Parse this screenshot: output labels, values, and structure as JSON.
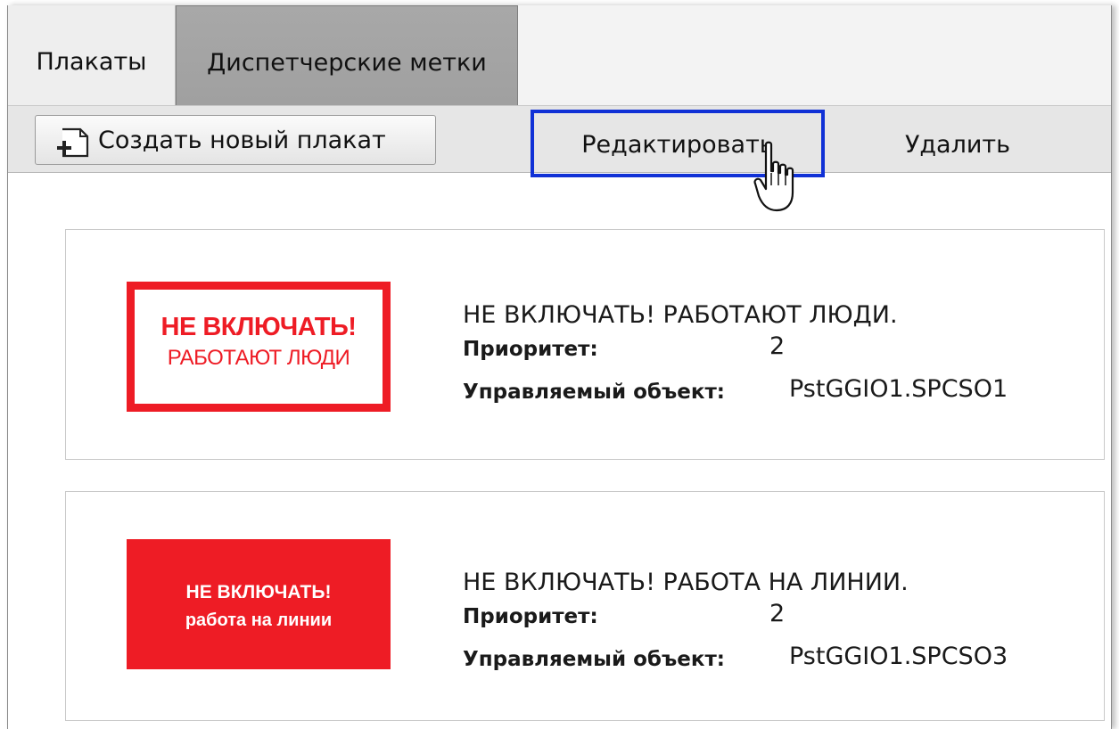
{
  "tabs": {
    "posters": "Плакаты",
    "dispatch_marks": "Диспетчерские метки"
  },
  "toolbar": {
    "create_label": "Создать новый плакат",
    "edit_label": "Редактировать",
    "delete_label": "Удалить"
  },
  "colors": {
    "sign_red": "#ee1c25",
    "highlight_blue": "#1031d6"
  },
  "posters": [
    {
      "sign_line1": "НЕ ВКЛЮЧАТЬ!",
      "sign_line2": "РАБОТАЮТ ЛЮДИ",
      "title": "НЕ ВКЛЮЧАТЬ! РАБОТАЮТ ЛЮДИ.",
      "priority_label": "Приоритет:",
      "priority": "2",
      "object_label": "Управляемый объект:",
      "object": "PstGGIO1.SPCSO1"
    },
    {
      "sign_line1": "НЕ ВКЛЮЧАТЬ!",
      "sign_line2": "работа на линии",
      "title": "НЕ ВКЛЮЧАТЬ! РАБОТА НА ЛИНИИ.",
      "priority_label": "Приоритет:",
      "priority": "2",
      "object_label": "Управляемый объект:",
      "object": "PstGGIO1.SPCSO3"
    }
  ]
}
